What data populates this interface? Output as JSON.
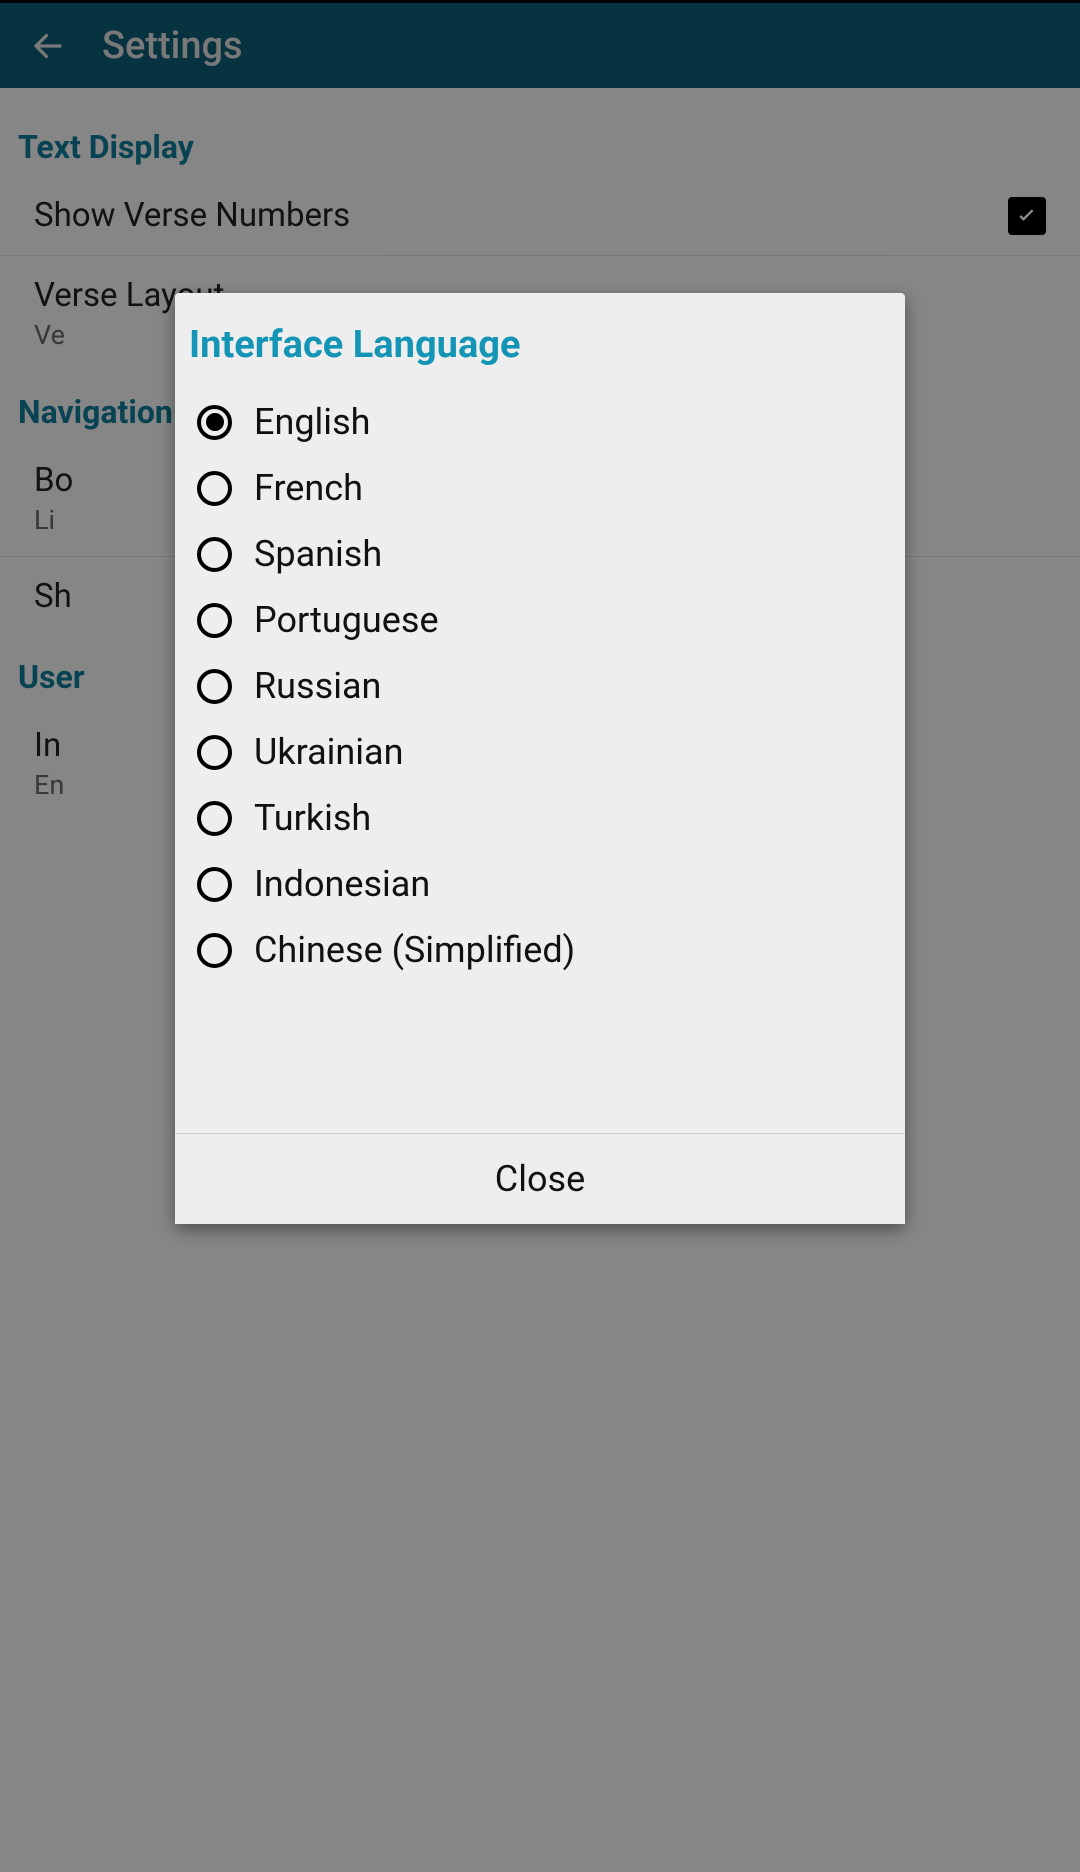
{
  "topbar": {
    "title": "Settings"
  },
  "sections": {
    "text_display": {
      "header": "Text Display"
    },
    "navigation": {
      "header": "Navigation"
    },
    "user": {
      "header": "User"
    }
  },
  "settings": {
    "show_verse_numbers": {
      "title": "Show Verse Numbers"
    },
    "verse_layout": {
      "title": "Verse Layout",
      "subtitle": "Ve"
    },
    "book": {
      "title": "Bo",
      "subtitle": "Li"
    },
    "sh": {
      "title": "Sh"
    },
    "interface_lang": {
      "title": "In",
      "subtitle": "En"
    }
  },
  "dialog": {
    "title": "Interface Language",
    "close": "Close",
    "options": {
      "english": "English",
      "french": "French",
      "spanish": "Spanish",
      "portuguese": "Portuguese",
      "russian": "Russian",
      "ukrainian": "Ukrainian",
      "turkish": "Turkish",
      "indonesian": "Indonesian",
      "chinese": "Chinese (Simplified)"
    },
    "selected": "english"
  }
}
